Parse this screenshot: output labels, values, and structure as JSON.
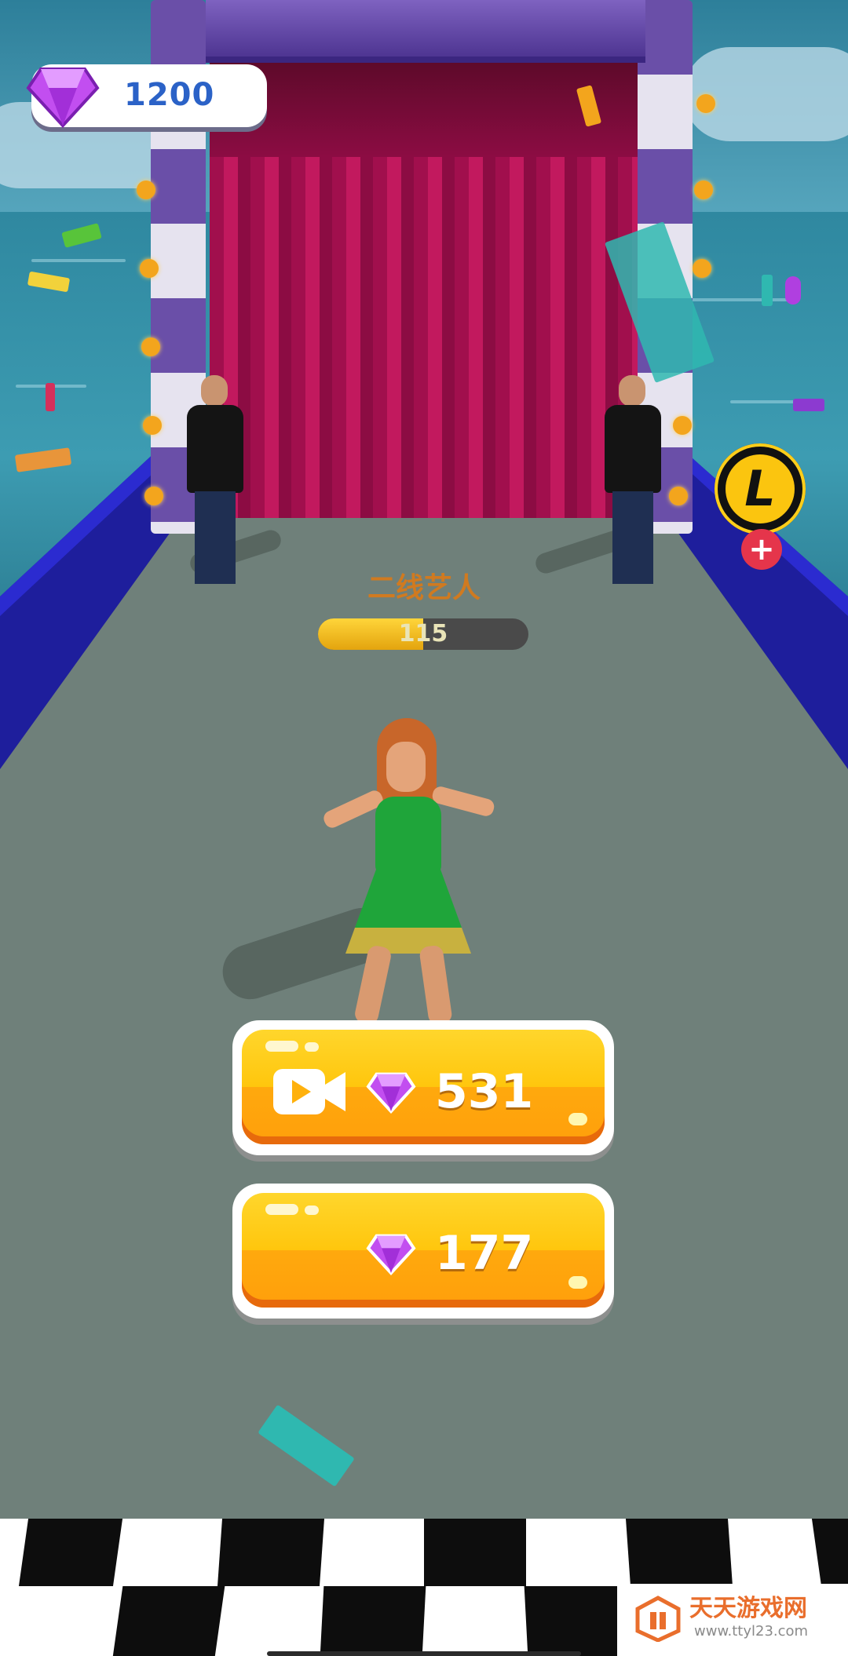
{
  "hud": {
    "gem_count": "1200",
    "level_letter": "L",
    "level_plus": "+"
  },
  "rank": {
    "title": "二线艺人",
    "progress_value": "115",
    "progress_fraction": 0.5
  },
  "buttons": {
    "video_reward": {
      "icon": "video-camera-icon",
      "gem_icon": "gem-icon",
      "amount": "531"
    },
    "claim": {
      "gem_icon": "gem-icon",
      "amount": "177"
    }
  },
  "watermark": {
    "text": "天天游戏网",
    "url": "www.ttyl23.com"
  },
  "colors": {
    "gem": "#b03fe0",
    "button_yellow": "#ffc60d",
    "gem_count_text": "#2b62c7",
    "rank_title": "#d07a20"
  }
}
